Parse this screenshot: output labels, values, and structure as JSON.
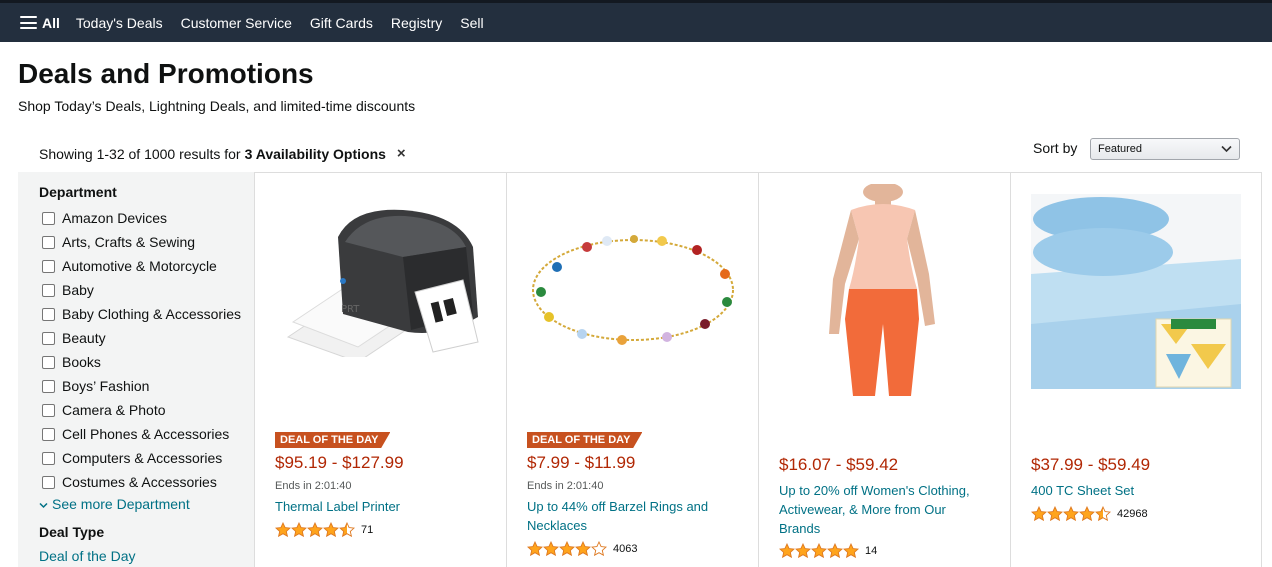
{
  "nav": {
    "all_label": "All",
    "links": [
      "Today's Deals",
      "Customer Service",
      "Gift Cards",
      "Registry",
      "Sell"
    ]
  },
  "header": {
    "title": "Deals and Promotions",
    "subtitle": "Shop Today’s Deals, Lightning Deals, and limited-time discounts"
  },
  "results": {
    "prefix": "Showing 1-32 of 1000 results for",
    "filter": "3 Availability Options",
    "clear": "×"
  },
  "sort": {
    "label": "Sort by",
    "selected": "Featured"
  },
  "sidebar": {
    "department_heading": "Department",
    "departments": [
      "Amazon Devices",
      "Arts, Crafts & Sewing",
      "Automotive & Motorcycle",
      "Baby",
      "Baby Clothing & Accessories",
      "Beauty",
      "Books",
      "Boys’ Fashion",
      "Camera & Photo",
      "Cell Phones & Accessories",
      "Computers & Accessories",
      "Costumes & Accessories"
    ],
    "see_more": "See more Department",
    "deal_type_heading": "Deal Type",
    "deal_of_the_day": "Deal of the Day"
  },
  "products": [
    {
      "badge": "DEAL OF THE DAY",
      "price": "$95.19 - $127.99",
      "ends": "Ends in 2:01:40",
      "title": "Thermal Label Printer",
      "stars": 4.5,
      "reviews": "71"
    },
    {
      "badge": "DEAL OF THE DAY",
      "price": "$7.99 - $11.99",
      "ends": "Ends in 2:01:40",
      "title": "Up to 44% off Barzel Rings and Necklaces",
      "stars": 4,
      "reviews": "4063"
    },
    {
      "badge": "",
      "price": "$16.07 - $59.42",
      "ends": "",
      "title": "Up to 20% off Women's Clothing, Activewear, & More from Our Brands",
      "stars": 5,
      "reviews": "14"
    },
    {
      "badge": "",
      "price": "$37.99 - $59.49",
      "ends": "",
      "title": "400 TC Sheet Set",
      "stars": 4.5,
      "reviews": "42968"
    }
  ],
  "colors": {
    "nav_bg": "#232f3e",
    "price": "#b12704",
    "link": "#007185",
    "badge": "#c7511f",
    "star": "#ffa41c"
  },
  "icons": {
    "menu": "hamburger-icon",
    "clear": "close-icon",
    "sort": "chevron-down-icon",
    "see_more": "chevron-down-icon",
    "rating": "star-icon"
  }
}
